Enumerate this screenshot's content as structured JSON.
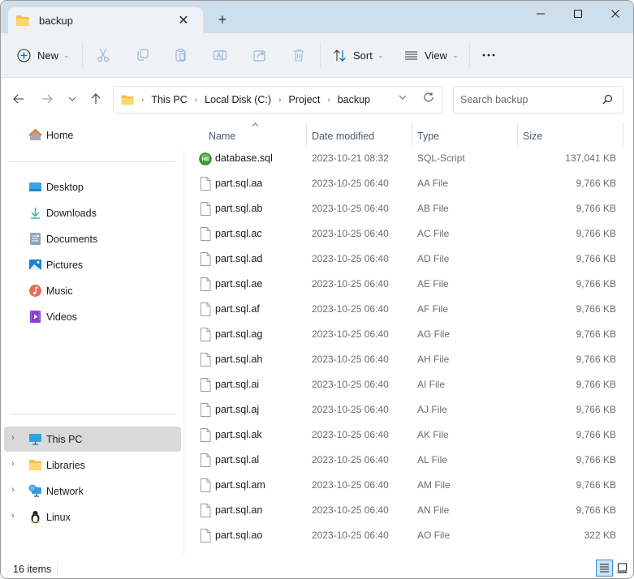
{
  "window": {
    "tab_title": "backup",
    "controls": {
      "minimize": "minimize",
      "maximize": "maximize",
      "close": "close"
    }
  },
  "toolbar": {
    "new_label": "New",
    "sort_label": "Sort",
    "view_label": "View",
    "icons": [
      "cut-icon",
      "copy-icon",
      "paste-icon",
      "rename-icon",
      "share-icon",
      "delete-icon",
      "more-icon"
    ]
  },
  "address": {
    "crumbs": [
      "This PC",
      "Local Disk (C:)",
      "Project",
      "backup"
    ],
    "search_placeholder": "Search backup"
  },
  "sidebar": {
    "home": "Home",
    "quick": [
      {
        "label": "Desktop",
        "icon": "desktop-icon"
      },
      {
        "label": "Downloads",
        "icon": "downloads-icon"
      },
      {
        "label": "Documents",
        "icon": "documents-icon"
      },
      {
        "label": "Pictures",
        "icon": "pictures-icon"
      },
      {
        "label": "Music",
        "icon": "music-icon"
      },
      {
        "label": "Videos",
        "icon": "videos-icon"
      }
    ],
    "tree": [
      {
        "label": "This PC",
        "icon": "this-pc-icon",
        "selected": true
      },
      {
        "label": "Libraries",
        "icon": "libraries-icon",
        "selected": false
      },
      {
        "label": "Network",
        "icon": "network-icon",
        "selected": false
      },
      {
        "label": "Linux",
        "icon": "linux-icon",
        "selected": false
      }
    ]
  },
  "filelist": {
    "columns": {
      "name": "Name",
      "date": "Date modified",
      "type": "Type",
      "size": "Size"
    },
    "sort_column": "Name",
    "sort_direction": "ascending",
    "rows": [
      {
        "name": "database.sql",
        "date": "2023-10-21 08:32",
        "type": "SQL-Script",
        "size": "137,041 KB",
        "icon": "sql-script-icon"
      },
      {
        "name": "part.sql.aa",
        "date": "2023-10-25 06:40",
        "type": "AA File",
        "size": "9,766 KB",
        "icon": "file-icon"
      },
      {
        "name": "part.sql.ab",
        "date": "2023-10-25 06:40",
        "type": "AB File",
        "size": "9,766 KB",
        "icon": "file-icon"
      },
      {
        "name": "part.sql.ac",
        "date": "2023-10-25 06:40",
        "type": "AC File",
        "size": "9,766 KB",
        "icon": "file-icon"
      },
      {
        "name": "part.sql.ad",
        "date": "2023-10-25 06:40",
        "type": "AD File",
        "size": "9,766 KB",
        "icon": "file-icon"
      },
      {
        "name": "part.sql.ae",
        "date": "2023-10-25 06:40",
        "type": "AE File",
        "size": "9,766 KB",
        "icon": "file-icon"
      },
      {
        "name": "part.sql.af",
        "date": "2023-10-25 06:40",
        "type": "AF File",
        "size": "9,766 KB",
        "icon": "file-icon"
      },
      {
        "name": "part.sql.ag",
        "date": "2023-10-25 06:40",
        "type": "AG File",
        "size": "9,766 KB",
        "icon": "file-icon"
      },
      {
        "name": "part.sql.ah",
        "date": "2023-10-25 06:40",
        "type": "AH File",
        "size": "9,766 KB",
        "icon": "file-icon"
      },
      {
        "name": "part.sql.ai",
        "date": "2023-10-25 06:40",
        "type": "AI File",
        "size": "9,766 KB",
        "icon": "file-icon"
      },
      {
        "name": "part.sql.aj",
        "date": "2023-10-25 06:40",
        "type": "AJ File",
        "size": "9,766 KB",
        "icon": "file-icon"
      },
      {
        "name": "part.sql.ak",
        "date": "2023-10-25 06:40",
        "type": "AK File",
        "size": "9,766 KB",
        "icon": "file-icon"
      },
      {
        "name": "part.sql.al",
        "date": "2023-10-25 06:40",
        "type": "AL File",
        "size": "9,766 KB",
        "icon": "file-icon"
      },
      {
        "name": "part.sql.am",
        "date": "2023-10-25 06:40",
        "type": "AM File",
        "size": "9,766 KB",
        "icon": "file-icon"
      },
      {
        "name": "part.sql.an",
        "date": "2023-10-25 06:40",
        "type": "AN File",
        "size": "9,766 KB",
        "icon": "file-icon"
      },
      {
        "name": "part.sql.ao",
        "date": "2023-10-25 06:40",
        "type": "AO File",
        "size": "322 KB",
        "icon": "file-icon"
      }
    ]
  },
  "status": {
    "item_count": "16 items",
    "view_mode": "details"
  },
  "colors": {
    "titlebar": "#cfdeeb",
    "commandbar": "#eef2f7",
    "accent": "#0067c0",
    "selected_nav": "#dadada",
    "secondary_text": "#6d6d6d"
  }
}
